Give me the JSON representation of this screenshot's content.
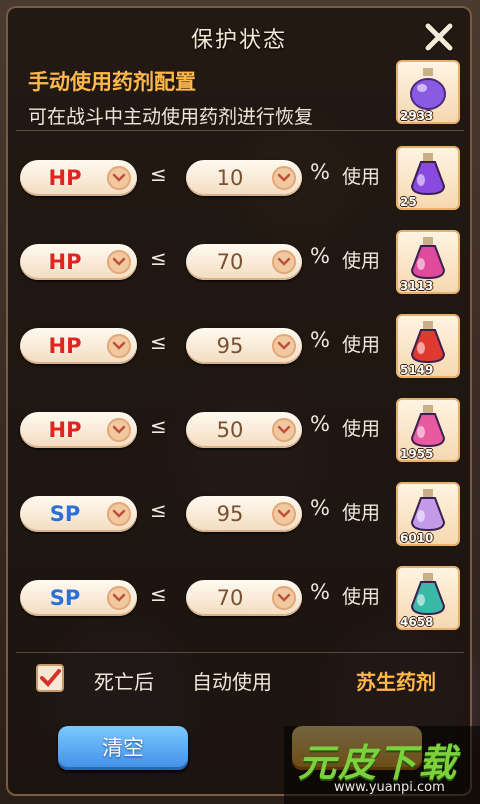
{
  "window": {
    "title": "保护状态",
    "close_icon": "close-icon"
  },
  "header": {
    "title": "手动使用药剂配置",
    "subtitle": "可在战斗中主动使用药剂进行恢复",
    "potion": {
      "icon": "purple-potion-icon",
      "count": "2933",
      "color": "#8a5ae0"
    }
  },
  "rows": [
    {
      "stat": "HP",
      "operator": "≤",
      "value": "10",
      "unit": "%",
      "action": "使用",
      "potion_count": "25",
      "potion_icon": "purple-flask-icon",
      "color": "#8a4ae0"
    },
    {
      "stat": "HP",
      "operator": "≤",
      "value": "70",
      "unit": "%",
      "action": "使用",
      "potion_count": "3113",
      "potion_icon": "pink-potion-icon",
      "color": "#e04a9a"
    },
    {
      "stat": "HP",
      "operator": "≤",
      "value": "95",
      "unit": "%",
      "action": "使用",
      "potion_count": "5149",
      "potion_icon": "red-potion-icon",
      "color": "#e03a30"
    },
    {
      "stat": "HP",
      "operator": "≤",
      "value": "50",
      "unit": "%",
      "action": "使用",
      "potion_count": "1955",
      "potion_icon": "pink-flask-icon",
      "color": "#e85aa0"
    },
    {
      "stat": "SP",
      "operator": "≤",
      "value": "95",
      "unit": "%",
      "action": "使用",
      "potion_count": "6010",
      "potion_icon": "lavender-potion-icon",
      "color": "#c29ae8"
    },
    {
      "stat": "SP",
      "operator": "≤",
      "value": "70",
      "unit": "%",
      "action": "使用",
      "potion_count": "4658",
      "potion_icon": "teal-potion-icon",
      "color": "#3ab8a8"
    }
  ],
  "footer": {
    "checkbox_checked": true,
    "death_label": "死亡后",
    "auto_label": "自动使用",
    "revive_label": "苏生药剂"
  },
  "buttons": {
    "clear": "清空"
  },
  "watermark": {
    "text": "元皮下载",
    "url": "www.yuanpi.com"
  },
  "colors": {
    "hp": "#e0241e",
    "sp": "#2e6fd4",
    "accent": "#ffb84a"
  }
}
